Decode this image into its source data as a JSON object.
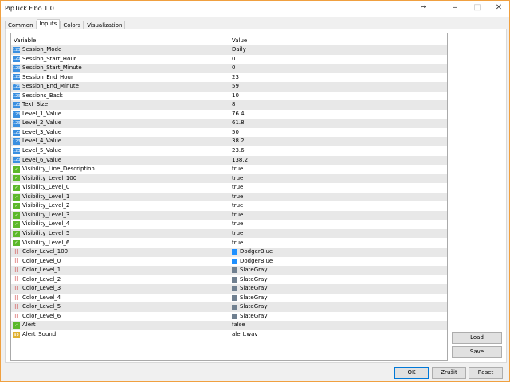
{
  "window": {
    "title": "PipTick Fibo 1.0"
  },
  "tabs": [
    "Common",
    "Inputs",
    "Colors",
    "Visualization"
  ],
  "active_tab": "Inputs",
  "table": {
    "headers": {
      "variable": "Variable",
      "value": "Value"
    },
    "rows": [
      {
        "type": "int",
        "name": "Session_Mode",
        "value": "Daily"
      },
      {
        "type": "int",
        "name": "Session_Start_Hour",
        "value": "0"
      },
      {
        "type": "int",
        "name": "Session_Start_Minute",
        "value": "0"
      },
      {
        "type": "int",
        "name": "Session_End_Hour",
        "value": "23"
      },
      {
        "type": "int",
        "name": "Session_End_Minute",
        "value": "59"
      },
      {
        "type": "int",
        "name": "Sessions_Back",
        "value": "10"
      },
      {
        "type": "int",
        "name": "Text_Size",
        "value": "8"
      },
      {
        "type": "dbl",
        "name": "Level_1_Value",
        "value": "76.4"
      },
      {
        "type": "dbl",
        "name": "Level_2_Value",
        "value": "61.8"
      },
      {
        "type": "dbl",
        "name": "Level_3_Value",
        "value": "50"
      },
      {
        "type": "dbl",
        "name": "Level_4_Value",
        "value": "38.2"
      },
      {
        "type": "dbl",
        "name": "Level_5_Value",
        "value": "23.6"
      },
      {
        "type": "dbl",
        "name": "Level_6_Value",
        "value": "138.2"
      },
      {
        "type": "bool",
        "name": "Visibility_Line_Description",
        "value": "true"
      },
      {
        "type": "bool",
        "name": "Visibility_Level_100",
        "value": "true"
      },
      {
        "type": "bool",
        "name": "Visibility_Level_0",
        "value": "true"
      },
      {
        "type": "bool",
        "name": "Visibility_Level_1",
        "value": "true"
      },
      {
        "type": "bool",
        "name": "Visibility_Level_2",
        "value": "true"
      },
      {
        "type": "bool",
        "name": "Visibility_Level_3",
        "value": "true"
      },
      {
        "type": "bool",
        "name": "Visibility_Level_4",
        "value": "true"
      },
      {
        "type": "bool",
        "name": "Visibility_Level_5",
        "value": "true"
      },
      {
        "type": "bool",
        "name": "Visibility_Level_6",
        "value": "true"
      },
      {
        "type": "color",
        "name": "Color_Level_100",
        "value": "DodgerBlue",
        "swatch": "#1e90ff"
      },
      {
        "type": "color",
        "name": "Color_Level_0",
        "value": "DodgerBlue",
        "swatch": "#1e90ff"
      },
      {
        "type": "color",
        "name": "Color_Level_1",
        "value": "SlateGray",
        "swatch": "#708090"
      },
      {
        "type": "color",
        "name": "Color_Level_2",
        "value": "SlateGray",
        "swatch": "#708090"
      },
      {
        "type": "color",
        "name": "Color_Level_3",
        "value": "SlateGray",
        "swatch": "#708090"
      },
      {
        "type": "color",
        "name": "Color_Level_4",
        "value": "SlateGray",
        "swatch": "#708090"
      },
      {
        "type": "color",
        "name": "Color_Level_5",
        "value": "SlateGray",
        "swatch": "#708090"
      },
      {
        "type": "color",
        "name": "Color_Level_6",
        "value": "SlateGray",
        "swatch": "#708090"
      },
      {
        "type": "bool",
        "name": "Alert",
        "value": "false"
      },
      {
        "type": "str",
        "name": "Alert_Sound",
        "value": "alert.wav"
      }
    ]
  },
  "buttons": {
    "load": "Load",
    "save": "Save",
    "ok": "OK",
    "cancel": "Zrušit",
    "reset": "Reset"
  }
}
